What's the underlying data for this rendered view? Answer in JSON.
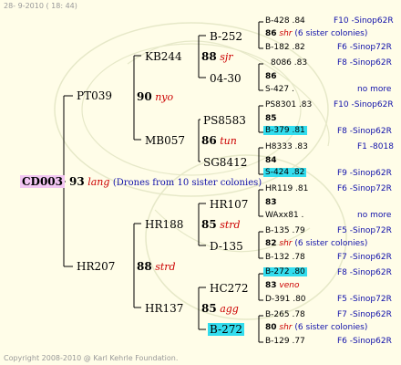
{
  "header": {
    "date": "28- 9-2010 ( 18: 44)"
  },
  "footer": {
    "copyright": "Copyright 2008-2010 @ Karl Kehrle Foundation."
  },
  "root": {
    "id": "CD003",
    "num": "93",
    "breed": "lang",
    "note": "(Drones from 10 sister colonies)"
  },
  "l1": [
    {
      "name": "PT039",
      "num": "90",
      "breed": "nyo"
    },
    {
      "name": "HR207",
      "num": "88",
      "breed": "strd"
    }
  ],
  "l2": [
    {
      "name": "KB244",
      "num": "88",
      "breed": "sjr"
    },
    {
      "name": "MB057",
      "num": "86",
      "breed": "tun"
    },
    {
      "name": "HR188",
      "num": "85",
      "breed": "strd"
    },
    {
      "name": "HR137",
      "num": "85",
      "breed": "agg"
    }
  ],
  "l3": [
    {
      "name": "B-252"
    },
    {
      "name": "04-30"
    },
    {
      "name": "PS8583"
    },
    {
      "name": "SG8412"
    },
    {
      "name": "HR107"
    },
    {
      "name": "D-135"
    },
    {
      "name": "HC272"
    },
    {
      "name": "B-272"
    }
  ],
  "l4": [
    {
      "a": "B-428 .84",
      "an": "F10 -Sinop62R",
      "num": "86",
      "b": "shr",
      "note": "(6 sister colonies)",
      "c": "B-182 .82",
      "cn": "F6 -Sinop72R"
    },
    {
      "a": "8086 .83",
      "an": "F8 -Sinop62R",
      "num": "86",
      "b": "",
      "note": "",
      "c": "S-427 .",
      "cn": "no more"
    },
    {
      "a": "PS8301 .83",
      "an": "F10 -Sinop62R",
      "num": "85",
      "b": "",
      "note": "",
      "c": "B-379 .81",
      "cn": "F8 -Sinop62R"
    },
    {
      "a": "H8333 .83",
      "an": "F1 -8018",
      "num": "84",
      "b": "",
      "note": "",
      "c": "S-424 .82",
      "cn": "F9 -Sinop62R"
    },
    {
      "a": "HR119 .81",
      "an": "F6 -Sinop72R",
      "num": "83",
      "b": "",
      "note": "",
      "c": "WAxx81 .",
      "cn": "no more"
    },
    {
      "a": "B-135 .79",
      "an": "F5 -Sinop72R",
      "num": "82",
      "b": "shr",
      "note": "(6 sister colonies)",
      "c": "B-132 .78",
      "cn": "F7 -Sinop62R"
    },
    {
      "a": "B-272 .80",
      "an": "F8 -Sinop62R",
      "num": "83",
      "b": "veno",
      "note": "",
      "c": "D-391 .80",
      "cn": "F5 -Sinop72R"
    },
    {
      "a": "B-265 .78",
      "an": "F7 -Sinop62R",
      "num": "80",
      "b": "shr",
      "note": "(6 sister colonies)",
      "c": "B-129 .77",
      "cn": "F6 -Sinop62R"
    }
  ]
}
